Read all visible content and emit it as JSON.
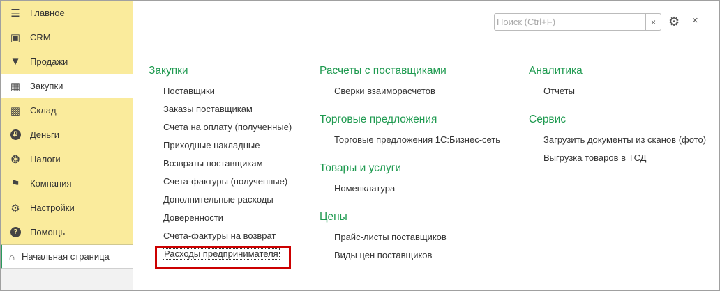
{
  "sidebar": {
    "items": [
      {
        "label": "Главное",
        "icon": "menu-icon"
      },
      {
        "label": "CRM",
        "icon": "contact-card-icon"
      },
      {
        "label": "Продажи",
        "icon": "basket-icon"
      },
      {
        "label": "Закупки",
        "icon": "cart-icon",
        "active": true
      },
      {
        "label": "Склад",
        "icon": "warehouse-icon"
      },
      {
        "label": "Деньги",
        "icon": "ruble-icon"
      },
      {
        "label": "Налоги",
        "icon": "eagle-icon"
      },
      {
        "label": "Компания",
        "icon": "flag-icon"
      },
      {
        "label": "Настройки",
        "icon": "gear-icon"
      },
      {
        "label": "Помощь",
        "icon": "help-icon"
      }
    ],
    "home": "Начальная страница"
  },
  "search": {
    "placeholder": "Поиск (Ctrl+F)",
    "value": ""
  },
  "columns": [
    [
      {
        "title": "Закупки",
        "items": [
          "Поставщики",
          "Заказы поставщикам",
          "Счета на оплату (полученные)",
          "Приходные накладные",
          "Возвраты поставщикам",
          "Счета-фактуры (полученные)",
          "Дополнительные расходы",
          "Доверенности",
          "Счета-фактуры на возврат",
          "Расходы предпринимателя"
        ]
      }
    ],
    [
      {
        "title": "Расчеты с поставщиками",
        "items": [
          "Сверки взаиморасчетов"
        ]
      },
      {
        "title": "Торговые предложения",
        "items": [
          "Торговые предложения 1С:Бизнес-сеть"
        ]
      },
      {
        "title": "Товары и услуги",
        "items": [
          "Номенклатура"
        ]
      },
      {
        "title": "Цены",
        "items": [
          "Прайс-листы поставщиков",
          "Виды цен поставщиков"
        ]
      }
    ],
    [
      {
        "title": "Аналитика",
        "items": [
          "Отчеты"
        ]
      },
      {
        "title": "Сервис",
        "items": [
          "Загрузить документы из сканов (фото)",
          "Выгрузка товаров в ТСД"
        ]
      }
    ]
  ],
  "highlighted": "Расходы предпринимателя"
}
